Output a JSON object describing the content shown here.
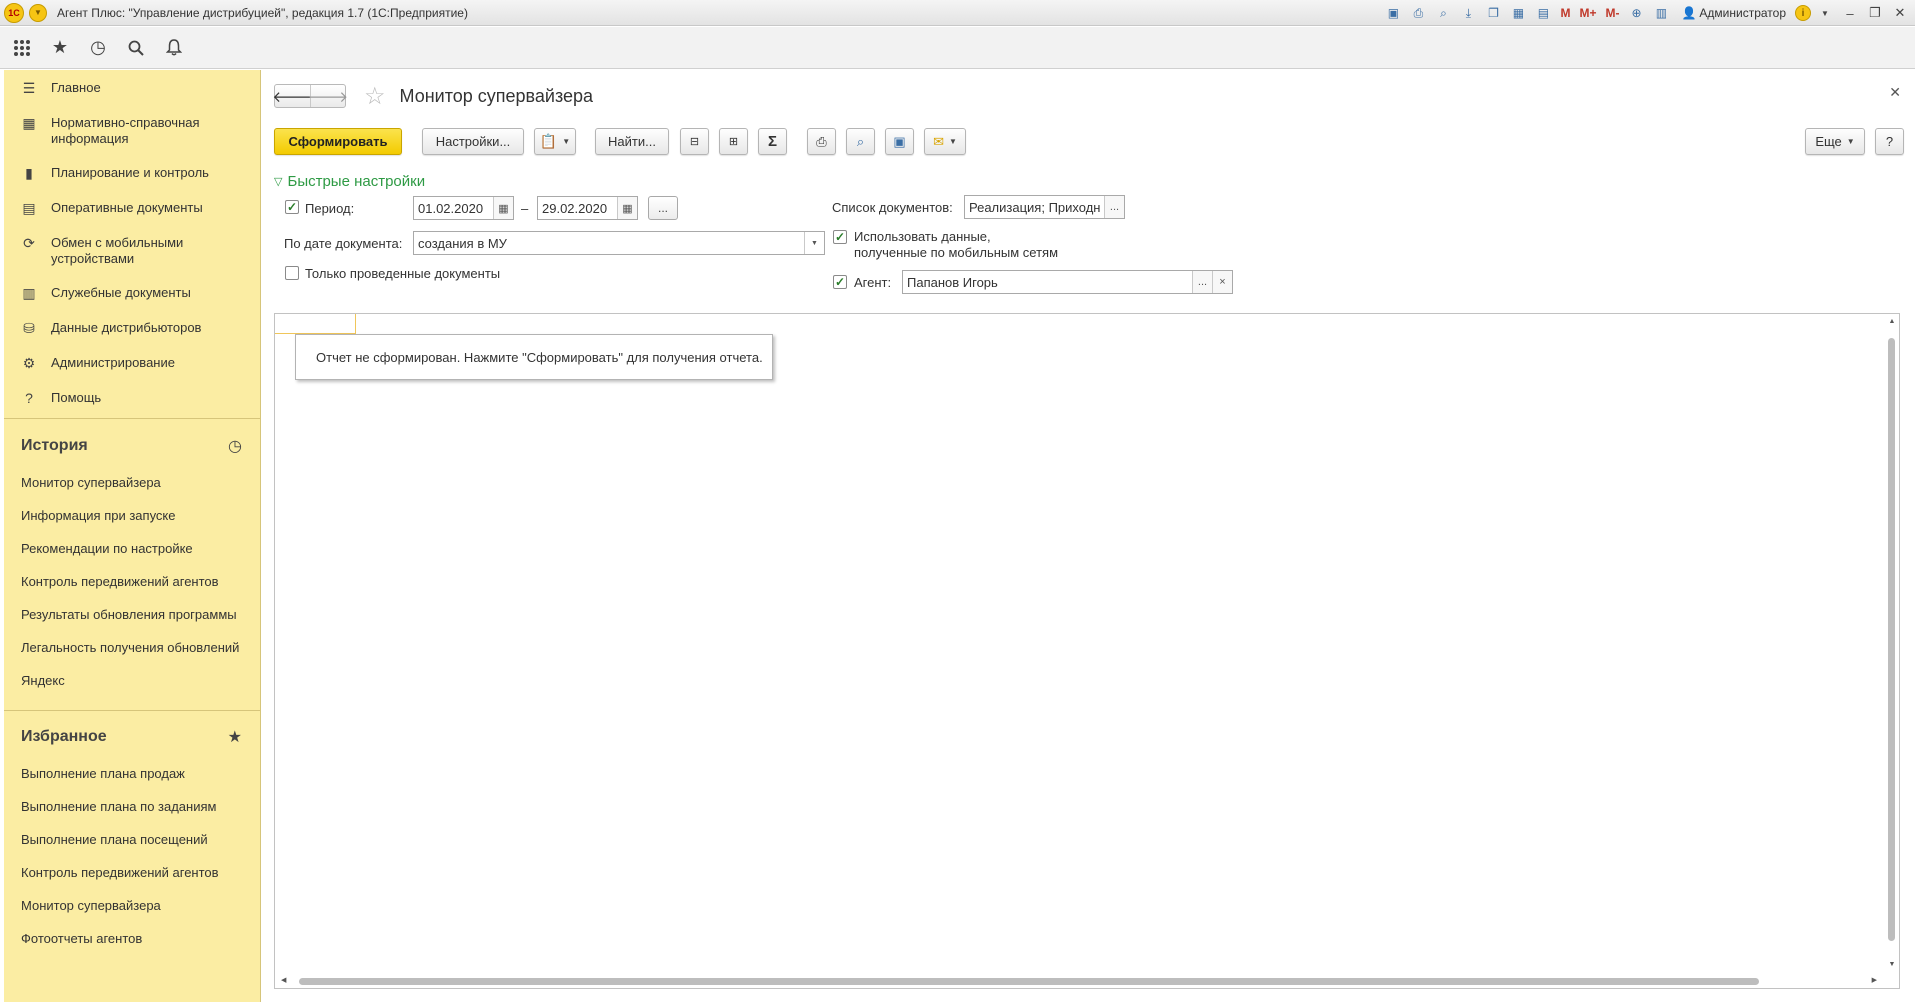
{
  "window": {
    "title": "Агент Плюс: \"Управление дистрибуцией\", редакция 1.7  (1С:Предприятие)",
    "logo": "1С",
    "user": "Администратор",
    "tools": [
      "save-icon",
      "print-icon",
      "preview-icon",
      "download-icon",
      "copy-icon",
      "calculator-icon",
      "calendar-icon"
    ],
    "m_buttons": [
      "M",
      "M+",
      "M-"
    ]
  },
  "sidebar": {
    "nav": [
      {
        "label": "Главное",
        "icon": "menu-icon"
      },
      {
        "label": "Нормативно-справочная информация",
        "icon": "table-icon"
      },
      {
        "label": "Планирование и контроль",
        "icon": "bar-chart-icon"
      },
      {
        "label": "Оперативные документы",
        "icon": "documents-icon"
      },
      {
        "label": "Обмен с мобильными устройствами",
        "icon": "sync-icon"
      },
      {
        "label": "Служебные документы",
        "icon": "service-docs-icon"
      },
      {
        "label": "Данные дистрибьюторов",
        "icon": "distributor-icon"
      },
      {
        "label": "Администрирование",
        "icon": "gear-icon"
      },
      {
        "label": "Помощь",
        "icon": "help-icon"
      }
    ],
    "history": {
      "title": "История",
      "items": [
        "Монитор супервайзера",
        "Информация при запуске",
        "Рекомендации по настройке",
        "Контроль передвижений агентов",
        "Результаты обновления программы",
        "Легальность получения обновлений",
        "Яндекс"
      ]
    },
    "favorites": {
      "title": "Избранное",
      "items": [
        "Выполнение плана продаж",
        "Выполнение плана по заданиям",
        "Выполнение плана посещений",
        "Контроль передвижений агентов",
        "Монитор супервайзера",
        "Фотоотчеты агентов"
      ]
    }
  },
  "main": {
    "title": "Монитор супервайзера",
    "buttons": {
      "generate": "Сформировать",
      "settings": "Настройки...",
      "find": "Найти...",
      "more": "Еще",
      "help": "?",
      "sum": "Σ"
    },
    "quick_settings": {
      "title": "Быстрые настройки",
      "period_label": "Период:",
      "period_from": "01.02.2020",
      "dash": "–",
      "period_to": "29.02.2020",
      "ellipsis": "...",
      "by_date_label": "По дате документа:",
      "by_date_value": "создания в МУ",
      "only_posted_label": "Только проведенные документы",
      "doc_list_label": "Список документов:",
      "doc_list_value": "Реализация; Приходн",
      "use_mobile_line1": "Использовать данные,",
      "use_mobile_line2": "полученные по мобильным сетям",
      "agent_label": "Агент:",
      "agent_value": "Папанов Игорь",
      "clear": "×"
    },
    "report_message": "Отчет не сформирован. Нажмите \"Сформировать\" для получения отчета."
  }
}
